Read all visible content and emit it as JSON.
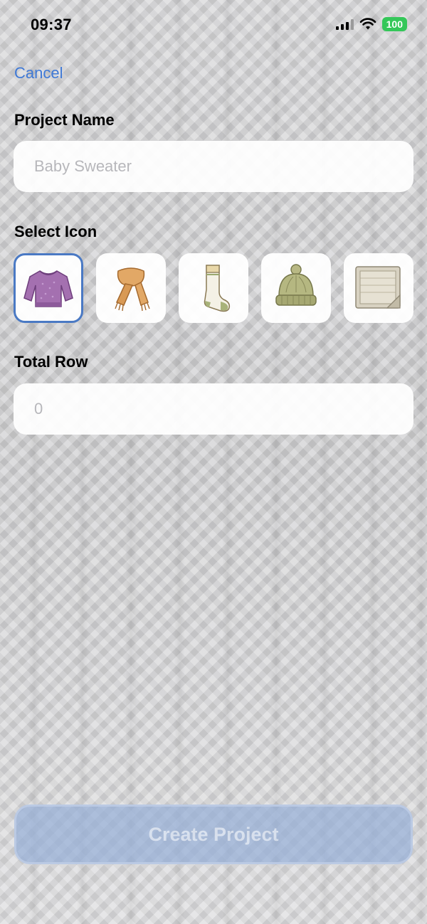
{
  "status_bar": {
    "time": "09:37",
    "battery": "100"
  },
  "nav": {
    "cancel_label": "Cancel"
  },
  "project_name": {
    "label": "Project Name",
    "placeholder": "Baby Sweater",
    "value": ""
  },
  "icon_picker": {
    "label": "Select Icon",
    "icons": [
      {
        "name": "sweater-icon",
        "selected": true
      },
      {
        "name": "scarf-icon",
        "selected": false
      },
      {
        "name": "sock-icon",
        "selected": false
      },
      {
        "name": "beanie-icon",
        "selected": false
      },
      {
        "name": "blanket-icon",
        "selected": false
      }
    ],
    "selection_color": "#4a79c4"
  },
  "total_row": {
    "label": "Total Row",
    "placeholder": "0",
    "value": ""
  },
  "create_button": {
    "label": "Create Project"
  },
  "colors": {
    "accent": "#3f79d6",
    "battery": "#34c759"
  }
}
